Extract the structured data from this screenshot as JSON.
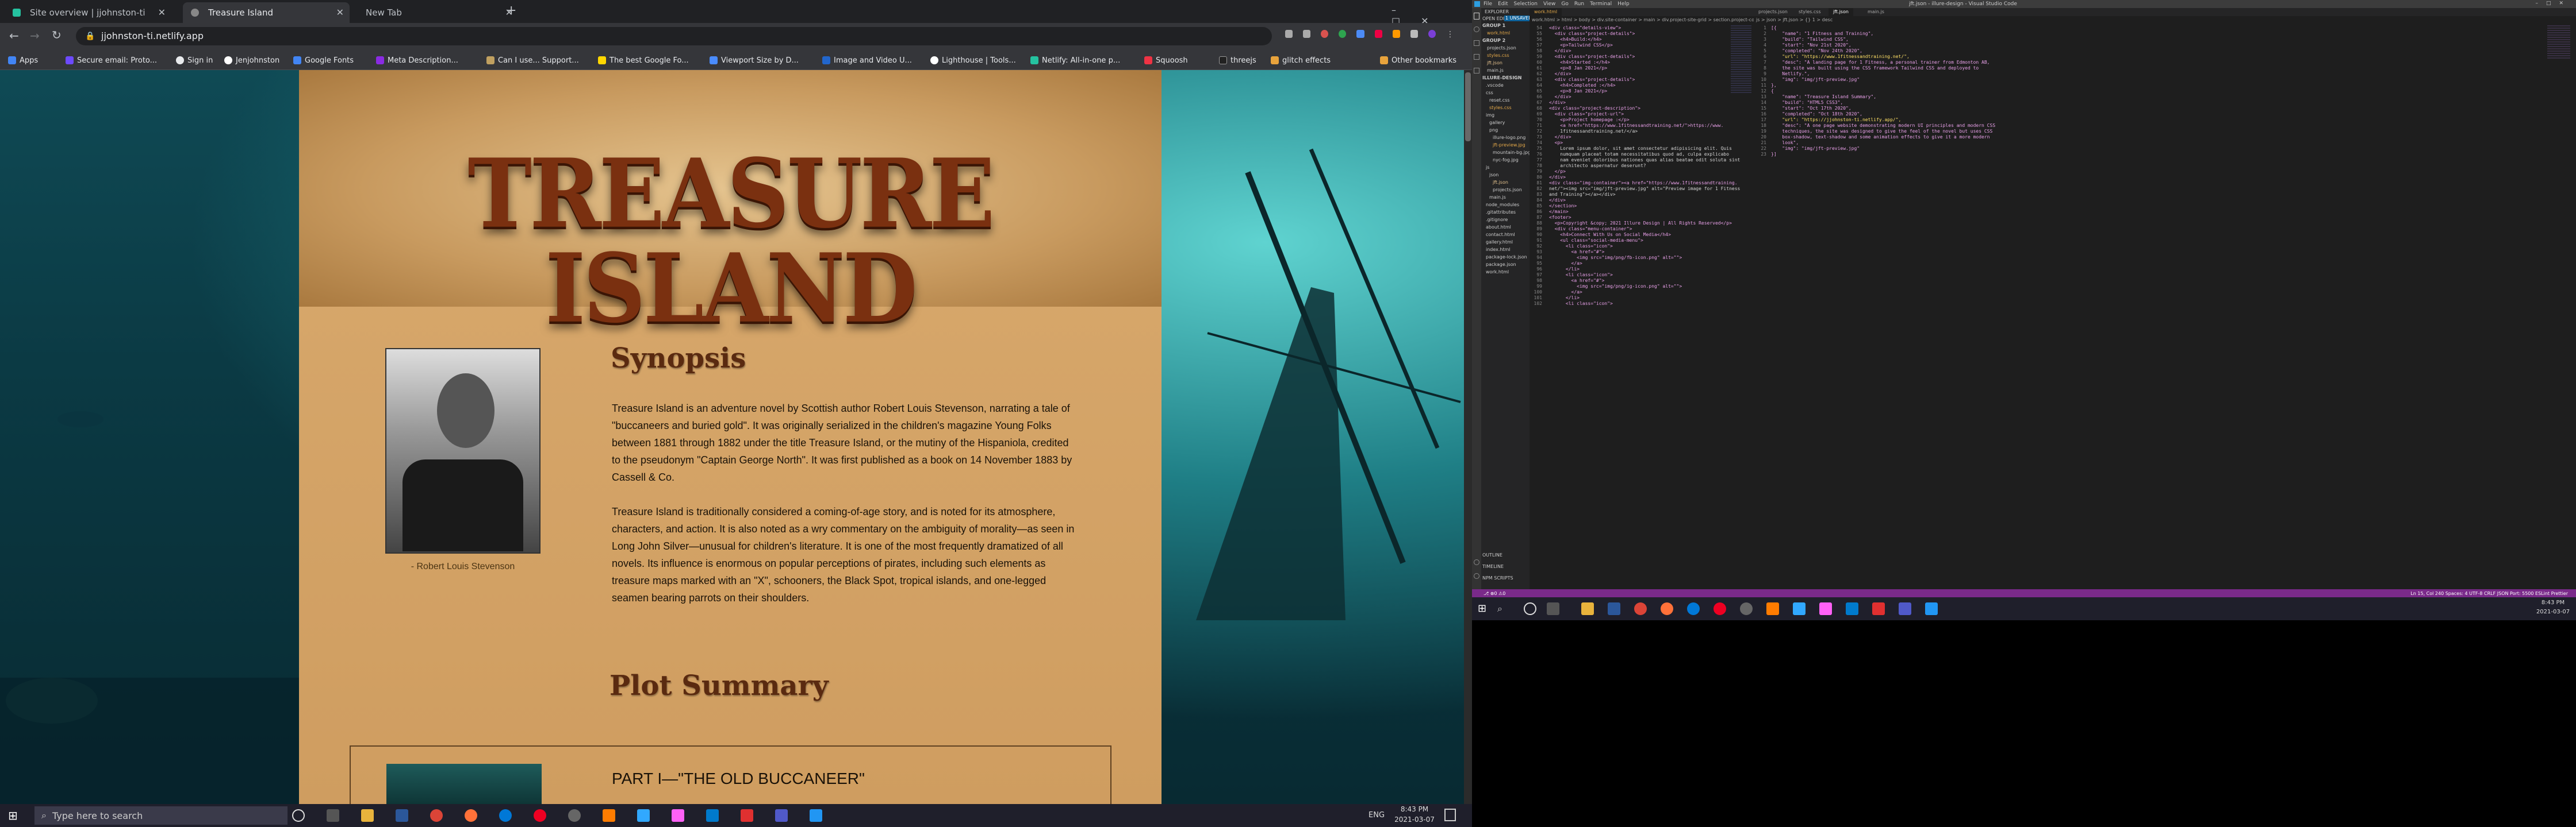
{
  "browser": {
    "tabs": [
      {
        "label": "Site overview | jjohnston-ti"
      },
      {
        "label": "Treasure Island"
      },
      {
        "label": "New Tab"
      }
    ],
    "url": "jjohnston-ti.netlify.app",
    "bookmarks": [
      "Apps",
      "Secure email: Proto...",
      "Sign in",
      "Jenjohnston",
      "Google Fonts",
      "Meta Description...",
      "Can I use... Support...",
      "The best Google Fo...",
      "Viewport Size by D...",
      "Image and Video U...",
      "Lighthouse | Tools...",
      "Netlify: All-in-one p...",
      "Squoosh",
      "threejs",
      "glitch effects",
      "Other bookmarks"
    ]
  },
  "site": {
    "hero_title": "TREASURE ISLAND",
    "synopsis_heading": "Synopsis",
    "synopsis_p1": "Treasure Island is an adventure novel by Scottish author Robert Louis Stevenson, narrating a tale of \"buccaneers and buried gold\". It was originally serialized in the children's magazine Young Folks between 1881 through 1882 under the title Treasure Island, or the mutiny of the Hispaniola, credited to the pseudonym \"Captain George North\". It was first published as a book on 14 November 1883 by Cassell & Co.",
    "synopsis_p2": "Treasure Island is traditionally considered a coming-of-age story, and is noted for its atmosphere, characters, and action. It is also noted as a wry commentary on the ambiguity of morality—as seen in Long John Silver—unusual for children's literature. It is one of the most frequently dramatized of all novels. Its influence is enormous on popular perceptions of pirates, including such elements as treasure maps marked with an \"X\", schooners, the Black Spot, tropical islands, and one-legged seamen bearing parrots on their shoulders.",
    "portrait_caption": "- Robert Louis Stevenson",
    "plot_heading": "Plot Summary",
    "part1_heading": "PART I—\"THE OLD BUCCANEER\""
  },
  "taskbar": {
    "search_placeholder": "Type here to search",
    "lang": "ENG",
    "time": "8:43 PM",
    "date": "2021-03-07"
  },
  "vscode": {
    "title": "jft.json - illure-design - Visual Studio Code",
    "menu": [
      "File",
      "Edit",
      "Selection",
      "View",
      "Go",
      "Run",
      "Terminal",
      "Help"
    ],
    "explorer_title": "EXPLORER",
    "open_editors": "OPEN EDITORS",
    "unsaved": "1 UNSAVED",
    "tabs_left": [
      "work.html"
    ],
    "tabs_right": [
      "projects.json",
      "styles.css",
      "jft.json",
      "main.js"
    ],
    "breadcrumb_left": "work.html > html > body > div.site-container > main > div.project-site-grid > section.project-container",
    "breadcrumb_right": "js > json > jft.json > {} 1 > desc",
    "explorer_items": [
      "GROUP 1",
      "work.html",
      "GROUP 2",
      "projects.json",
      "styles.css",
      "jft.json",
      "main.js",
      "ILLURE-DESIGN",
      ".vscode",
      "css",
      "reset.css",
      "styles.css",
      "img",
      "gallery",
      "png",
      "illure-logo.png",
      "jft-preview.jpg",
      "mountain-bg.jpg",
      "nyc-fog.jpg",
      "js",
      "json",
      "jft.json",
      "projects.json",
      "main.js",
      "node_modules",
      ".gitattributes",
      ".gitignore",
      "about.html",
      "contact.html",
      "gallery.html",
      "index.html",
      "package-lock.json",
      "package.json",
      "work.html"
    ],
    "outline": "OUTLINE",
    "timeline": "TIMELINE",
    "npm_scripts": "NPM SCRIPTS",
    "status_right": "Ln 15, Col 240   Spaces: 4   UTF-8   CRLF   JSON   Port: 5500   ESLint   Prettier",
    "left_code": [
      "<div class=\"details-view\">",
      "  <div class=\"project-details\">",
      "    <h4>Build:</h4>",
      "    <p>Tailwind CSS</p>",
      "  </div>",
      "  <div class=\"project-details\">",
      "    <h4>Started :</h4>",
      "    <p>8 Jan 2021</p>",
      "  </div>",
      "  <div class=\"project-details\">",
      "    <h4>Completed :</h4>",
      "    <p>8 Jan 2021</p>",
      "  </div>",
      "</div>",
      "<div class=\"project-description\">",
      "  <div class=\"project-url\">",
      "    <p>Project homepage :</p>",
      "    <a href=\"https://www.1fitnessandtraining.net/\">https://www.",
      "    1fitnessandtraining.net/</a>",
      "  </div>",
      "  <p>",
      "    Lorem ipsum dolor, sit amet consectetur adipisicing elit. Quis",
      "    numquam placeat totam necessitatibus quod ad, culpa explicabo",
      "    nam eveniet doloribus nationes quas alias beatae odit soluta sint",
      "    architecto aspernatur deserunt?",
      "  </p>",
      "</div>",
      "<div class=\"img-container\"><a href=\"https://www.1fitnessandtraining.",
      "net/\"><img src=\"img/jft-preview.jpg\" alt=\"Preview image for 1 Fitness",
      "and Training\"></a></div>",
      "</div>",
      "</section>",
      "</main>",
      "<footer>",
      "  <p>Copyright &copy; 2021 Illure Design | All Rights Reserved</p>",
      "  <div class=\"menu-container\">",
      "    <h4>Connect With Us on Social Media</h4>",
      "    <ul class=\"social-media-menu\">",
      "      <li class=\"icon\">",
      "        <a href=\"#\">",
      "          <img src=\"img/png/fb-icon.png\" alt=\"\">",
      "        </a>",
      "      </li>",
      "      <li class=\"icon\">",
      "        <a href=\"#\">",
      "          <img src=\"img/png/ig-icon.png\" alt=\"\">",
      "        </a>",
      "      </li>",
      "      <li class=\"icon\">"
    ],
    "left_start_line": 54,
    "right_code": [
      "[{",
      "    \"name\": \"1 Fitness and Training\",",
      "    \"build\": \"Tailwind CSS\",",
      "    \"start\": \"Nov 21st 2020\",",
      "    \"completed\": \"Nov 24th 2020\",",
      "    \"url\": \"https://www.1fitnessandtraining.net/\",",
      "    \"desc\": \"A landing page for 1 Fitness, a personal trainer from Edmonton AB,",
      "    the site was built using the CSS framework Tailwind CSS and deployed to",
      "    Netlify.\",",
      "    \"img\": \"img/jft-preview.jpg\"",
      "},",
      "{",
      "    \"name\": \"Treasure Island Summary\",",
      "    \"build\": \"HTML5 CSS3\",",
      "    \"start\": \"Oct 17th 2020\",",
      "    \"completed\": \"Oct 18th 2020\",",
      "    \"url\": \"https://jjohnston-ti.netlify.app/\",",
      "    \"desc\": \"A one page website demonstrating modern UI principles and modern CSS",
      "    techniques, the site was designed to give the feel of the novel but uses CSS",
      "    box-shadow, text-shadow and some animation effects to give it a more modern",
      "    look\",",
      "    \"img\": \"img/jft-preview.jpg\"",
      "}]"
    ]
  }
}
